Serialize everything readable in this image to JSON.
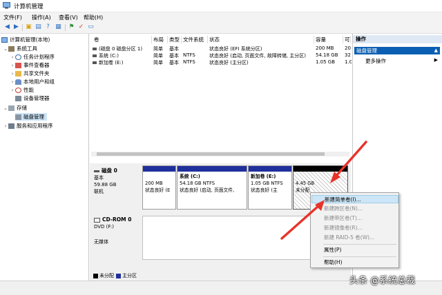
{
  "window": {
    "title": "计算机管理"
  },
  "menu": [
    "文件(F)",
    "操作(A)",
    "查看(V)",
    "帮助(H)"
  ],
  "tree": {
    "root": "计算机管理(本地)",
    "system_tools": "系统工具",
    "task_scheduler": "任务计划程序",
    "event_viewer": "事件查看器",
    "shared_folders": "共享文件夹",
    "local_users": "本地用户和组",
    "performance": "性能",
    "device_manager": "设备管理器",
    "storage": "存储",
    "disk_management": "磁盘管理",
    "services_apps": "服务和应用程序"
  },
  "volume_table": {
    "headers": [
      "卷",
      "布局",
      "类型",
      "文件系统",
      "状态",
      "容量",
      "可"
    ],
    "rows": [
      [
        "(磁盘 0 磁盘分区 1)",
        "简单",
        "基本",
        "",
        "状态良好 (EFI 系统分区)",
        "200 MB",
        "20"
      ],
      [
        "系统 (C:)",
        "简单",
        "基本",
        "NTFS",
        "状态良好 (启动, 页面文件, 故障转储, 主分区)",
        "54.18 GB",
        "32"
      ],
      [
        "新加卷 (E:)",
        "简单",
        "基本",
        "NTFS",
        "状态良好 (主分区)",
        "1.05 GB",
        "1.0"
      ]
    ]
  },
  "disk0": {
    "name": "磁盘 0",
    "type": "基本",
    "size": "59.88 GB",
    "status": "联机",
    "partitions": [
      {
        "label": "",
        "size": "200 MB",
        "status": "状态良好 (E"
      },
      {
        "label": "系统 (C:)",
        "size": "54.18 GB NTFS",
        "status": "状态良好 (启动, 页面文件,"
      },
      {
        "label": "新加卷 (E:)",
        "size": "1.05 GB NTFS",
        "status": "状态良好 (主"
      },
      {
        "label": "",
        "size": "4.45 GB",
        "status": "未分配"
      }
    ]
  },
  "cdrom": {
    "name": "CD-ROM 0",
    "type": "DVD (F:)",
    "status": "无媒体"
  },
  "legend": {
    "unallocated": "未分配",
    "primary": "主分区"
  },
  "actions": {
    "header": "操作",
    "disk_management": "磁盘管理",
    "more": "更多操作"
  },
  "context_menu": {
    "items": [
      {
        "label": "新建简单卷(I)...",
        "enabled": true
      },
      {
        "label": "新建跨区卷(N)...",
        "enabled": false
      },
      {
        "label": "新建带区卷(T)...",
        "enabled": false
      },
      {
        "label": "新建镜像卷(R)...",
        "enabled": false
      },
      {
        "label": "新建 RAID-5 卷(W)...",
        "enabled": false
      },
      {
        "label": "属性(P)",
        "enabled": true
      },
      {
        "label": "帮助(H)",
        "enabled": true
      }
    ]
  },
  "watermark": "头条 @系统总裁",
  "colors": {
    "primary_partition": "#1f2f9c",
    "unallocated": "#000000",
    "arrow": "#e8332a",
    "selection": "#0b5fb2"
  }
}
